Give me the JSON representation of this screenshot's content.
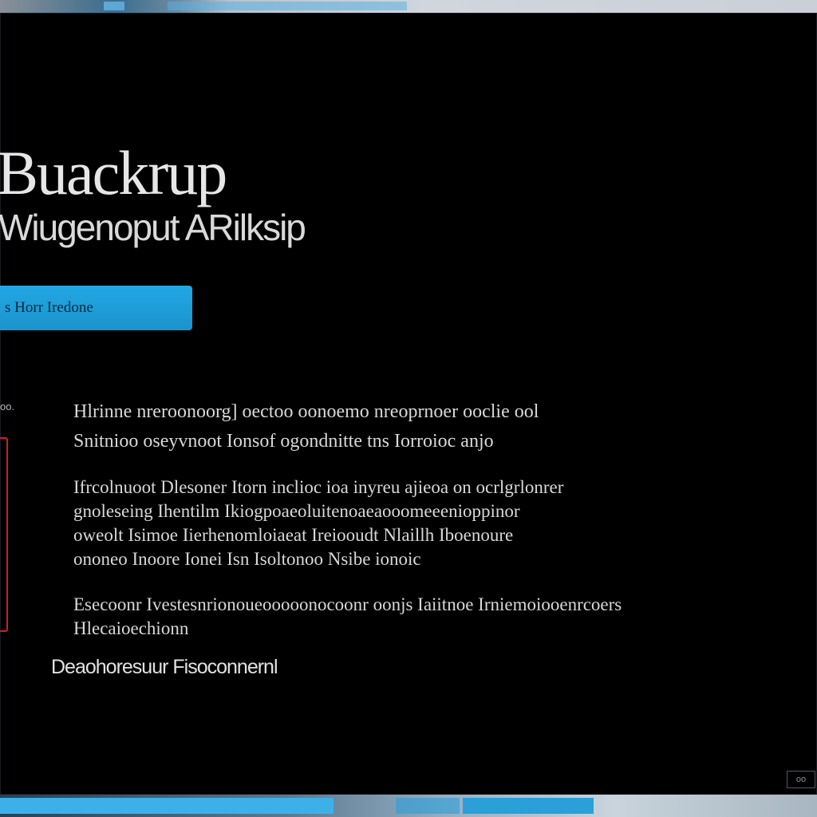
{
  "window": {
    "title": "Buackrup",
    "subtitle": "Wiugenoput ARilksip"
  },
  "primary_button": {
    "label": "s Horr Iredone"
  },
  "side_label": "oo.",
  "paragraphs": [
    {
      "lines": [
        "Hlrinne nreroonoorg] oectoo oonoemo nreoprnoer ooclie ool",
        "Snitnioo oseyvnoot Ionsof ogondnitte tns Iorroioc anjo"
      ]
    },
    {
      "lines": [
        "Ifrcolnuoot Dlesoner Itorn inclioc ioa inyreu ajieoa on ocrlgrlonrer",
        "gnoleseing Ihentilm Ikiogpoaeoluitenoaeaooomeeenioppinor",
        "oweolt Isimoe Iierhenomloiaeat Ireiooudt Nlaillh Iboenoure",
        "ononeo Inoore Ionei Isn Isoltonoo Nsibe ionoic"
      ]
    },
    {
      "lines": [
        "Esecoonr Ivestesnrionoueooooonocoonr oonjs Iaiitnoe Irniemoiooenrcoers",
        "Hlecaioechionn"
      ]
    }
  ],
  "footer_link": "Deaohoresuur Fisoconnernl",
  "corner_badge": "oo",
  "colors": {
    "background": "#000000",
    "accent": "#22a7e4",
    "alert": "#c8202a",
    "text": "#d8d8d8"
  }
}
